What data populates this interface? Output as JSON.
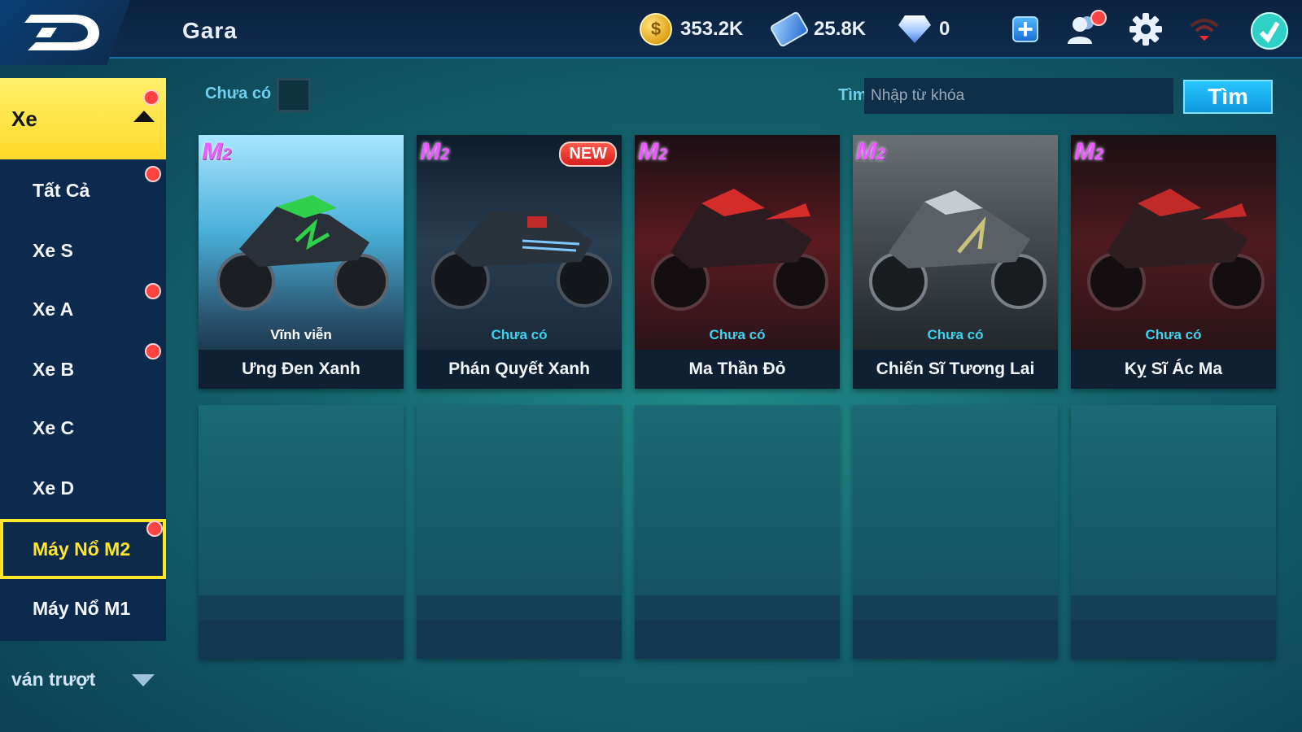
{
  "header": {
    "title": "Gara",
    "gold": "353.2K",
    "cards": "25.8K",
    "diamonds": "0"
  },
  "sidebar": {
    "category": "Xe",
    "items": [
      {
        "label": "Tất Cả"
      },
      {
        "label": "Xe S"
      },
      {
        "label": "Xe A"
      },
      {
        "label": "Xe B"
      },
      {
        "label": "Xe C"
      },
      {
        "label": "Xe D"
      },
      {
        "label": "Máy Nổ M2"
      },
      {
        "label": "Máy Nổ M1"
      }
    ],
    "footer": "ván trượt"
  },
  "filter": {
    "label": "Chưa có"
  },
  "search": {
    "label": "Tìm",
    "placeholder": "Nhập từ khóa",
    "button": "Tìm"
  },
  "cards": [
    {
      "badge": "M2",
      "status": "Vĩnh viễn",
      "name": "Ưng Đen Xanh",
      "new": "",
      "color": "#2fd04a"
    },
    {
      "badge": "M2",
      "status": "Chưa có",
      "name": "Phán Quyết Xanh",
      "new": "NEW",
      "color": "#7ec8ff"
    },
    {
      "badge": "M2",
      "status": "Chưa có",
      "name": "Ma Thần Đỏ",
      "new": "",
      "color": "#d42b2b"
    },
    {
      "badge": "M2",
      "status": "Chưa có",
      "name": "Chiến Sĩ Tương Lai",
      "new": "",
      "color": "#c9c27a"
    },
    {
      "badge": "M2",
      "status": "Chưa có",
      "name": "Kỵ Sĩ Ác Ma",
      "new": "",
      "color": "#c22a2a"
    }
  ],
  "colors": {
    "accent_yellow": "#ffe629",
    "accent_cyan": "#6fd0ee",
    "status_owned": "#ffffff",
    "status_not_owned": "#39d4f0",
    "notification": "#ff4242"
  }
}
